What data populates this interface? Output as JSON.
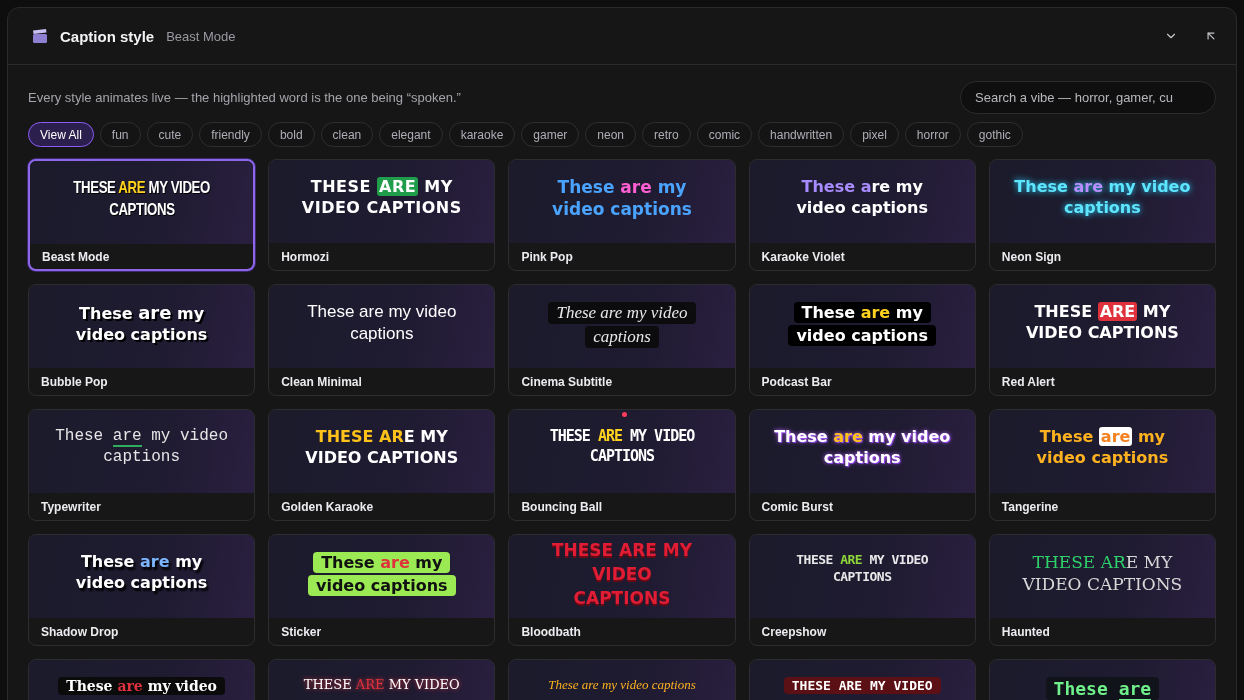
{
  "header": {
    "title": "Caption style",
    "current": "Beast Mode"
  },
  "hint": "Every style animates live — the highlighted word is the one being “spoken.”",
  "search": {
    "placeholder": "Search a vibe — horror, gamer, cu"
  },
  "filters": [
    {
      "label": "View All",
      "selected": true
    },
    {
      "label": "fun",
      "selected": false
    },
    {
      "label": "cute",
      "selected": false
    },
    {
      "label": "friendly",
      "selected": false
    },
    {
      "label": "bold",
      "selected": false
    },
    {
      "label": "clean",
      "selected": false
    },
    {
      "label": "elegant",
      "selected": false
    },
    {
      "label": "karaoke",
      "selected": false
    },
    {
      "label": "gamer",
      "selected": false
    },
    {
      "label": "neon",
      "selected": false
    },
    {
      "label": "retro",
      "selected": false
    },
    {
      "label": "comic",
      "selected": false
    },
    {
      "label": "handwritten",
      "selected": false
    },
    {
      "label": "pixel",
      "selected": false
    },
    {
      "label": "horror",
      "selected": false
    },
    {
      "label": "gothic",
      "selected": false
    }
  ],
  "styles": [
    {
      "name": "Beast Mode",
      "kind": "beast",
      "selected": true,
      "lines": [
        {
          "pre": "THESE ",
          "hl": "ARE",
          "post": " MY VIDEO"
        },
        {
          "pre": "CAPTIONS"
        }
      ]
    },
    {
      "name": "Hormozi",
      "kind": "hormozi",
      "selected": false,
      "lines": [
        {
          "pre": "THESE ",
          "hl": "ARE",
          "post": " MY"
        },
        {
          "pre": "VIDEO CAPTIONS"
        }
      ]
    },
    {
      "name": "Pink Pop",
      "kind": "pinkpop",
      "selected": false,
      "lines": [
        {
          "pre": "These ",
          "hl": "are",
          "post": " my"
        },
        {
          "pre": "video captions"
        }
      ]
    },
    {
      "name": "Karaoke Violet",
      "kind": "karaoke",
      "selected": false,
      "lines": [
        {
          "hl": "These a",
          "post": "re my"
        },
        {
          "pre": "video captions"
        }
      ]
    },
    {
      "name": "Neon Sign",
      "kind": "neon",
      "selected": false,
      "lines": [
        {
          "pre": "These ",
          "hl": "are",
          "post": " my video"
        },
        {
          "pre": "captions"
        }
      ]
    },
    {
      "name": "Bubble Pop",
      "kind": "bubble",
      "selected": false,
      "lines": [
        {
          "pre": "These ",
          "hl": "are",
          "post": " my"
        },
        {
          "pre": "video captions"
        }
      ]
    },
    {
      "name": "Clean Minimal",
      "kind": "minimal",
      "selected": false,
      "lines": [
        {
          "pre": "These are my video"
        },
        {
          "pre": "captions"
        }
      ]
    },
    {
      "name": "Cinema Subtitle",
      "kind": "cinema",
      "selected": false,
      "lines": [
        {
          "pre": "These are my video"
        },
        {
          "pre": "captions"
        }
      ]
    },
    {
      "name": "Podcast Bar",
      "kind": "podcast",
      "selected": false,
      "lines": [
        {
          "pre": "These ",
          "hl": "are",
          "post": " my"
        },
        {
          "pre": "video captions"
        }
      ]
    },
    {
      "name": "Red Alert",
      "kind": "redalert",
      "selected": false,
      "lines": [
        {
          "pre": "THESE ",
          "hl": "ARE",
          "post": " MY"
        },
        {
          "pre": "VIDEO CAPTIONS"
        }
      ]
    },
    {
      "name": "Typewriter",
      "kind": "typewriter",
      "selected": false,
      "lines": [
        {
          "pre": "These ",
          "hl": "are",
          "post": " my video"
        },
        {
          "pre": "captions"
        }
      ]
    },
    {
      "name": "Golden Karaoke",
      "kind": "golden",
      "selected": false,
      "lines": [
        {
          "hl": "THESE AR",
          "post": "E MY"
        },
        {
          "pre": "VIDEO CAPTIONS"
        }
      ]
    },
    {
      "name": "Bouncing Ball",
      "kind": "bouncing",
      "selected": false,
      "lines": [
        {
          "pre": "THESE ",
          "hl": "ARE",
          "post": " MY VIDEO"
        },
        {
          "pre": "CAPTIONS"
        }
      ]
    },
    {
      "name": "Comic Burst",
      "kind": "comic",
      "selected": false,
      "lines": [
        {
          "pre": "These ",
          "hl": "are",
          "post": " my video"
        },
        {
          "pre": "captions"
        }
      ]
    },
    {
      "name": "Tangerine",
      "kind": "tangerine",
      "selected": false,
      "lines": [
        {
          "pre": "These ",
          "hl": "are",
          "post": " my"
        },
        {
          "pre": "video captions"
        }
      ]
    },
    {
      "name": "Shadow Drop",
      "kind": "shadow",
      "selected": false,
      "lines": [
        {
          "pre": "These ",
          "hl": "are",
          "post": " my"
        },
        {
          "pre": "video captions"
        }
      ]
    },
    {
      "name": "Sticker",
      "kind": "sticker",
      "selected": false,
      "lines": [
        {
          "pre": "These ",
          "hl": "are",
          "post": " my"
        },
        {
          "pre": "video captions"
        }
      ]
    },
    {
      "name": "Bloodbath",
      "kind": "bloodbath",
      "selected": false,
      "lines": [
        {
          "pre": "THESE ARE MY"
        },
        {
          "pre": "VIDEO"
        },
        {
          "pre": "CAPTIONS"
        }
      ]
    },
    {
      "name": "Creepshow",
      "kind": "creepshow",
      "selected": false,
      "lines": [
        {
          "pre": "THESE ",
          "hl": "ARE",
          "post": " MY VIDEO"
        },
        {
          "pre": "CAPTIONS"
        }
      ]
    },
    {
      "name": "Haunted",
      "kind": "haunted",
      "selected": false,
      "lines": [
        {
          "hl": "THESE AR",
          "post": "E MY"
        },
        {
          "pre": "VIDEO CAPTIONS"
        }
      ]
    },
    {
      "kind": "gothic",
      "selected": false,
      "lines": [
        {
          "pre": "These ",
          "hl": "are",
          "post": " my video"
        }
      ]
    },
    {
      "kind": "vampire",
      "selected": false,
      "lines": [
        {
          "pre": "THESE ",
          "hl": "ARE",
          "post": " MY VIDEO"
        }
      ]
    },
    {
      "kind": "script",
      "selected": false,
      "lines": [
        {
          "pre": "These are my video captions"
        }
      ]
    },
    {
      "kind": "arcade",
      "selected": false,
      "lines": [
        {
          "pre": "THESE ",
          "hl": "ARE",
          "post": " MY VIDEO"
        }
      ]
    },
    {
      "kind": "pixel",
      "selected": false,
      "lines": [
        {
          "pre": "These ",
          "hl": "are"
        }
      ]
    }
  ]
}
